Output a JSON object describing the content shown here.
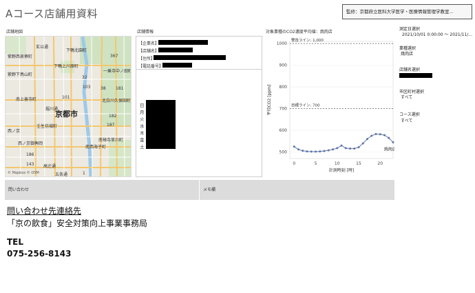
{
  "header": {
    "title": "Aコース店舗用資料",
    "supervisor": "監修：京都府立医科大学医学・医療情報管理学教室..."
  },
  "sections": {
    "map_label": "店舗地図",
    "info_label": "店舗情報",
    "chart_label": "対象業種のCO2濃度平均値：焼肉店"
  },
  "map": {
    "city": "京都市",
    "labels": [
      "玄以通",
      "下鴨北園町",
      "紫野西泉寮町",
      "下鴨上川原町",
      "紫野下鳥山町",
      "一乗寺中ノ田町",
      "南上善寺町",
      "北白川久保田町",
      "京都市",
      "壬生坊城町",
      "西ノ京御輿岡",
      "南禅寺草川町",
      "高辻通",
      "西ノ京",
      "五条通",
      "堀川通",
      "南西海子町"
    ],
    "route_numbers": [
      "367",
      "101",
      "32",
      "181",
      "103",
      "38",
      "182",
      "187",
      "186",
      "143",
      "1"
    ],
    "credit": "© Mapbox © OSM"
  },
  "store_info": {
    "fields": [
      "【企業名】",
      "【店舗名】",
      "【住所】",
      "【電話番号】"
    ],
    "days": [
      "日",
      "月",
      "火",
      "水",
      "木",
      "金",
      "土"
    ]
  },
  "chart_data": {
    "type": "line",
    "title": "対象業種のCO2濃度平均値：焼肉店",
    "xlabel": "計測時刻 [時]",
    "ylabel": "平均CO2 [ppm]",
    "xlim": [
      -1,
      23
    ],
    "ylim": [
      470,
      1010
    ],
    "xticks": [
      0,
      5,
      10,
      15,
      20
    ],
    "yticks": [
      500,
      600,
      700,
      800,
      900,
      1000
    ],
    "series": [
      {
        "name": "焼肉店",
        "x": [
          0,
          1,
          2,
          3,
          4,
          5,
          6,
          7,
          8,
          9,
          10,
          11,
          12,
          13,
          14,
          15,
          16,
          17,
          18,
          19,
          20,
          21,
          22,
          23
        ],
        "values": [
          525,
          512,
          506,
          503,
          502,
          502,
          503,
          505,
          508,
          512,
          518,
          530,
          518,
          516,
          516,
          522,
          540,
          560,
          575,
          583,
          582,
          578,
          565,
          545
        ]
      }
    ],
    "reference_lines": [
      {
        "label": "警告ライン: 1,000",
        "value": 1000
      },
      {
        "label": "目標ライン: 700",
        "value": 700
      }
    ],
    "series_label": "焼肉店"
  },
  "filters": {
    "date_label": "測定日選択",
    "date_value": "2021/10/01 0:00:00 ～ 2021/11/...",
    "industry_label": "業種選択",
    "industry_value": "焼肉店",
    "store_label": "店舗名選択",
    "city_label": "市区町村選択",
    "city_value": "すべて",
    "course_label": "コース選択",
    "course_value": "すべて"
  },
  "bars": {
    "inquiry": "問い合わせ",
    "memo": "メモ欄"
  },
  "contact": {
    "title": "問い合わせ先連絡先",
    "org": "「京の飲食」安全対策向上事業事務局",
    "tel_label": "TEL",
    "tel": "075-256-8143"
  },
  "colors": {
    "line": "#7b8fbf",
    "marker": "#5f73a3",
    "ref_line": "#666666",
    "bar_bg": "#dcdcdc",
    "redaction": "#000000"
  }
}
